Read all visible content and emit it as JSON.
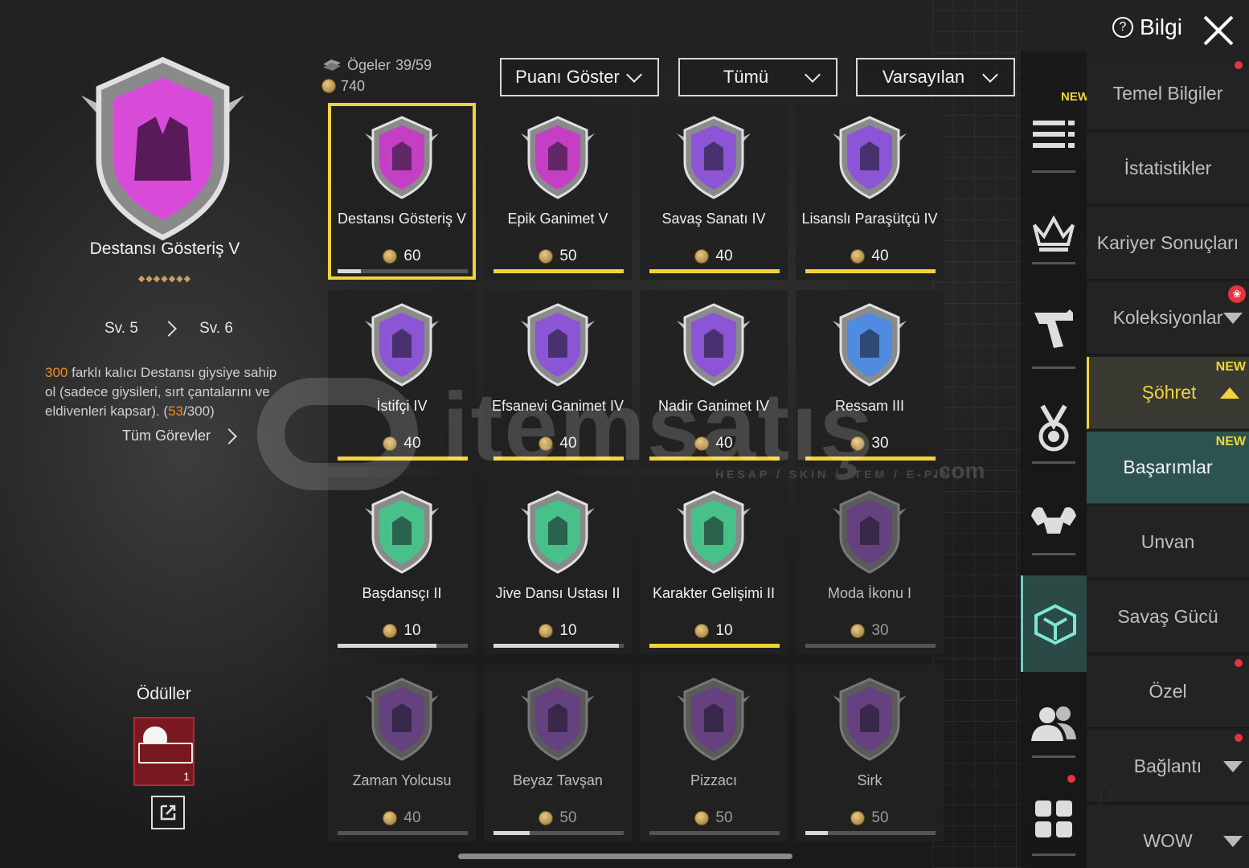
{
  "header": {
    "info_label": "Bilgi",
    "items_label": "Ögeler",
    "items_count": "39/59",
    "points_total": "740"
  },
  "filters": {
    "points": "Puanı Göster",
    "category": "Tümü",
    "sort": "Varsayılan"
  },
  "detail": {
    "name": "Destansı Gösteriş V",
    "dots": "◆◆◆◆◆◆◆",
    "level_from": "Sv. 5",
    "level_to": "Sv. 6",
    "desc_count": "300",
    "desc_text": " farklı kalıcı Destansı giysiye sahip ol (sadece giysileri, sırt çantalarını ve eldivenleri kapsar). (",
    "progress_current": "53",
    "progress_total": "/300)",
    "all_tasks": "Tüm Görevler",
    "rewards_label": "Ödüller",
    "reward_count": "1"
  },
  "achievements": [
    {
      "name": "Destansı Gösteriş V",
      "points": "60",
      "color": "#c43fc4",
      "progress": 0.18,
      "bar": "grey",
      "locked": false,
      "selected": true,
      "icon": "jacket-icon"
    },
    {
      "name": "Epik Ganimet V",
      "points": "50",
      "color": "#c43fc4",
      "progress": 1,
      "bar": "yellow",
      "locked": false,
      "selected": false,
      "icon": "jacket-icon"
    },
    {
      "name": "Savaş Sanatı IV",
      "points": "40",
      "color": "#8b55d6",
      "progress": 1,
      "bar": "yellow",
      "locked": false,
      "selected": false,
      "icon": "claw-icon"
    },
    {
      "name": "Lisanslı Paraşütçü IV",
      "points": "40",
      "color": "#8b55d6",
      "progress": 1,
      "bar": "yellow",
      "locked": false,
      "selected": false,
      "icon": "parachute-icon"
    },
    {
      "name": "İstifçi IV",
      "points": "40",
      "color": "#8b55d6",
      "progress": 1,
      "bar": "yellow",
      "locked": false,
      "selected": false,
      "icon": "wardrobe-icon"
    },
    {
      "name": "Efsanevi Ganimet IV",
      "points": "40",
      "color": "#8b55d6",
      "progress": 1,
      "bar": "yellow",
      "locked": false,
      "selected": false,
      "icon": "jacket-icon"
    },
    {
      "name": "Nadir Ganimet IV",
      "points": "40",
      "color": "#8b55d6",
      "progress": 1,
      "bar": "yellow",
      "locked": false,
      "selected": false,
      "icon": "jacket-icon"
    },
    {
      "name": "Ressam III",
      "points": "30",
      "color": "#4f8be0",
      "progress": 1,
      "bar": "yellow",
      "locked": false,
      "selected": false,
      "icon": "crosshair-icon"
    },
    {
      "name": "Başdansçı II",
      "points": "10",
      "color": "#48c08a",
      "progress": 0.76,
      "bar": "grey",
      "locked": false,
      "selected": false,
      "icon": "dancer-icon"
    },
    {
      "name": "Jive Dansı Ustası II",
      "points": "10",
      "color": "#48c08a",
      "progress": 0.96,
      "bar": "grey",
      "locked": false,
      "selected": false,
      "icon": "dancer-icon"
    },
    {
      "name": "Karakter Gelişimi II",
      "points": "10",
      "color": "#48c08a",
      "progress": 1,
      "bar": "yellow",
      "locked": false,
      "selected": false,
      "icon": "character-icon"
    },
    {
      "name": "Moda İkonu I",
      "points": "30",
      "color": "#6a3a8c",
      "progress": 0,
      "bar": "grey",
      "locked": true,
      "selected": false,
      "icon": "gem-icon"
    },
    {
      "name": "Zaman Yolcusu",
      "points": "40",
      "color": "#6a3a8c",
      "progress": 0,
      "bar": "grey",
      "locked": true,
      "selected": false,
      "icon": "hexagon-icon"
    },
    {
      "name": "Beyaz Tavşan",
      "points": "50",
      "color": "#6a3a8c",
      "progress": 0.28,
      "bar": "grey",
      "locked": true,
      "selected": false,
      "icon": "rabbit-icon"
    },
    {
      "name": "Pizzacı",
      "points": "50",
      "color": "#6a3a8c",
      "progress": 0,
      "bar": "grey",
      "locked": true,
      "selected": false,
      "icon": "pizza-icon"
    },
    {
      "name": "Sirk",
      "points": "50",
      "color": "#6a3a8c",
      "progress": 0.17,
      "bar": "grey",
      "locked": true,
      "selected": false,
      "icon": "circus-icon"
    }
  ],
  "side_new_label": "NEW",
  "menu": [
    {
      "label": "Temel Bilgiler",
      "state": "normal",
      "dot": true
    },
    {
      "label": "İstatistikler",
      "state": "normal"
    },
    {
      "label": "Kariyer Sonuçları",
      "state": "normal"
    },
    {
      "label": "Koleksiyonlar",
      "state": "normal",
      "arrow": "down",
      "gift": true
    },
    {
      "label": "Şöhret",
      "state": "yellow",
      "arrow": "up",
      "new": "NEW"
    },
    {
      "label": "Başarımlar",
      "state": "current",
      "new": "NEW"
    },
    {
      "label": "Unvan",
      "state": "normal"
    },
    {
      "label": "Savaş Gücü",
      "state": "normal"
    },
    {
      "label": "Özel",
      "state": "normal",
      "dot": true
    },
    {
      "label": "Bağlantı",
      "state": "normal",
      "arrow": "down",
      "dot": true
    },
    {
      "label": "WOW",
      "state": "normal",
      "arrow": "down"
    }
  ],
  "watermark": {
    "text": "itemsatış",
    "sub": "HESAP / SKIN / ITEM / E-PIN",
    "dotcom": ".com"
  }
}
